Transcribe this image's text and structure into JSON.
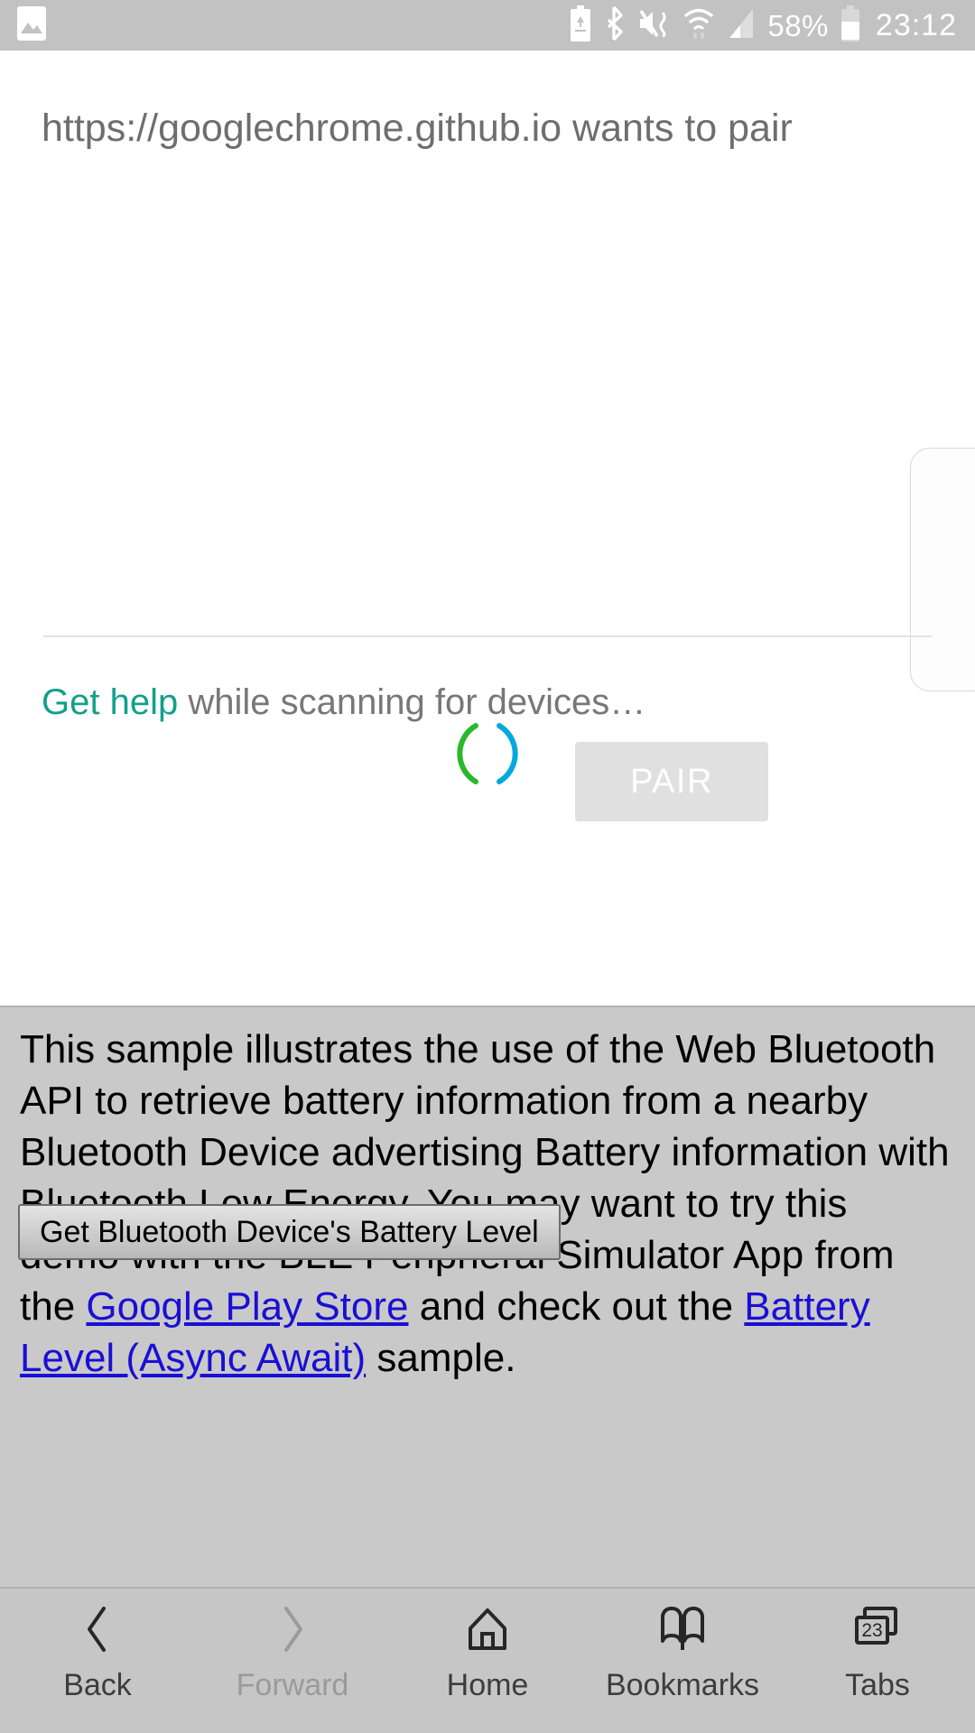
{
  "statusbar": {
    "left_icons": [
      {
        "name": "image-icon"
      }
    ],
    "right_icons": [
      {
        "name": "battery-saver-icon"
      },
      {
        "name": "bluetooth-icon"
      },
      {
        "name": "mute-vibrate-icon"
      },
      {
        "name": "wifi-icon"
      },
      {
        "name": "cellular-signal-icon"
      }
    ],
    "battery_percent": "58%",
    "battery_icon": "battery-icon",
    "clock": "23:12"
  },
  "dialog": {
    "title": "https://googlechrome.github.io wants to pair",
    "spinner": {
      "name": "loading-spinner",
      "left_arc_color": "#2cb82c",
      "right_arc_color": "#03a9dd"
    },
    "scanning": {
      "link_text": "Get help",
      "rest_text": " while scanning for devices…",
      "link_color": "#12a08a",
      "text_color": "#777777"
    },
    "pair_button": {
      "label": "PAIR",
      "disabled": true,
      "bg_color": "#e0e0e0",
      "text_color": "#ffffff"
    }
  },
  "page": {
    "paragraph": {
      "part1": "This sample illustrates the use of the Web Bluetooth API to retrieve battery information from a nearby Bluetooth Device advertising Battery information with Bluetooth Low Energy. You may want to try this demo with the BLE Peripheral Simulator App from the ",
      "link1": "Google Play Store",
      "part2": " and check out the ",
      "link2": "Battery Level (Async Await)",
      "part3": " sample.",
      "link_color": "#1a0fd4"
    },
    "battery_button_label": "Get Bluetooth Device's Battery Level"
  },
  "navbar": {
    "items": [
      {
        "label": "Back",
        "icon": "chevron-left-icon",
        "disabled": false
      },
      {
        "label": "Forward",
        "icon": "chevron-right-icon",
        "disabled": true
      },
      {
        "label": "Home",
        "icon": "home-icon",
        "disabled": false
      },
      {
        "label": "Bookmarks",
        "icon": "book-icon",
        "disabled": false
      },
      {
        "label": "Tabs",
        "icon": "tabs-icon",
        "disabled": false
      }
    ],
    "tab_count": "23"
  }
}
